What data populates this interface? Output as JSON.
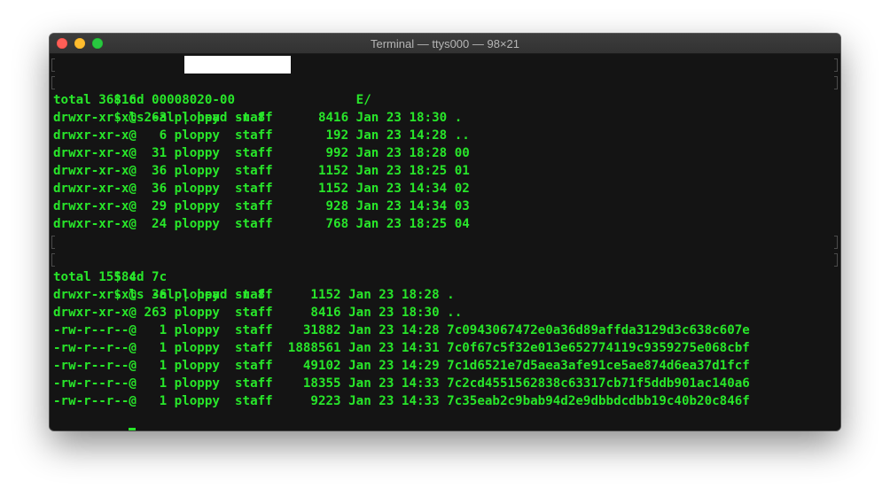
{
  "window": {
    "title": "Terminal — ttys000 — 98×21"
  },
  "colors": {
    "terminal_background": "#141414",
    "terminal_text": "#28e62a",
    "titlebar": "#383838",
    "close_button": "#fe5f57",
    "minimize_button": "#febc2e",
    "zoom_button": "#28c840"
  },
  "terminal": {
    "lines": [
      "$ cd 00008020-00                E/",
      "$ ls -al | head -n 8",
      "total 36816",
      "drwxr-xr-x@ 263 ploppy  staff      8416 Jan 23 18:30 .",
      "drwxr-xr-x@   6 ploppy  staff       192 Jan 23 14:28 ..",
      "drwxr-xr-x@  31 ploppy  staff       992 Jan 23 18:28 00",
      "drwxr-xr-x@  36 ploppy  staff      1152 Jan 23 18:25 01",
      "drwxr-xr-x@  36 ploppy  staff      1152 Jan 23 14:34 02",
      "drwxr-xr-x@  29 ploppy  staff       928 Jan 23 14:34 03",
      "drwxr-xr-x@  24 ploppy  staff       768 Jan 23 18:25 04",
      "$ cd 7c",
      "$ ls -al | head -n 8",
      "total 15584",
      "drwxr-xr-x@  36 ploppy  staff     1152 Jan 23 18:28 .",
      "drwxr-xr-x@ 263 ploppy  staff     8416 Jan 23 18:30 ..",
      "-rw-r--r--@   1 ploppy  staff    31882 Jan 23 14:28 7c0943067472e0a36d89affda3129d3c638c607e",
      "-rw-r--r--@   1 ploppy  staff  1888561 Jan 23 14:31 7c0f67c5f32e013e652774119c9359275e068cbf",
      "-rw-r--r--@   1 ploppy  staff    49102 Jan 23 14:29 7c1d6521e7d5aea3afe91ce5ae874d6ea37d1fcf",
      "-rw-r--r--@   1 ploppy  staff    18355 Jan 23 14:33 7c2cd4551562838c63317cb71f5ddb901ac140a6",
      "-rw-r--r--@   1 ploppy  staff     9223 Jan 23 14:33 7c35eab2c9bab94d2e9dbbdcdbb19c40b20c846f"
    ],
    "prompt": "$ "
  }
}
